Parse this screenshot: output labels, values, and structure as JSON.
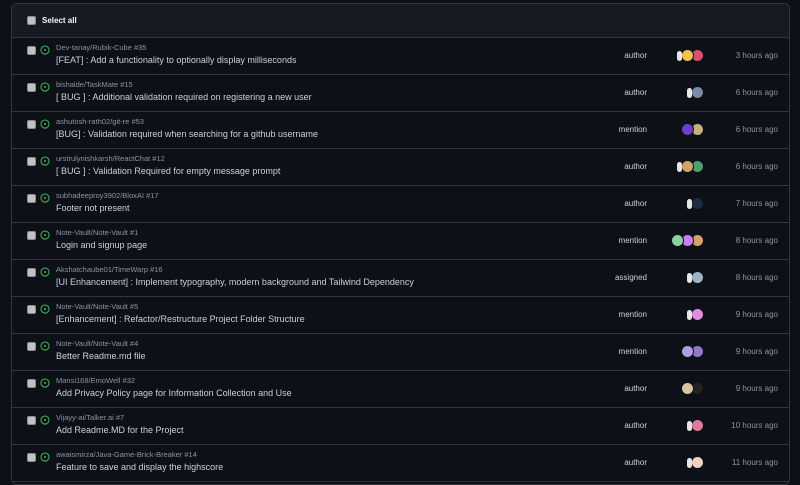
{
  "header": {
    "select_all_label": "Select all"
  },
  "colors": {
    "open_issue": "#3fb950",
    "muted": "#8b949e",
    "border": "#30363d"
  },
  "notifications": [
    {
      "repo": "Dev-tanay/Rubik-Cube #35",
      "title": "[FEAT] : Add a functionality to optionally display milliseconds",
      "reason": "author",
      "time": "3 hours ago",
      "avatars": [
        "#e6e6e6",
        "#f2c14e",
        "#d94f70"
      ]
    },
    {
      "repo": "bishalde/TaskMate #15",
      "title": "[ BUG ] : Additional validation required on registering a new user",
      "reason": "author",
      "time": "6 hours ago",
      "avatars": [
        "#e6e6e6",
        "#7a8ca5"
      ]
    },
    {
      "repo": "ashutosh-rath02/git-re #53",
      "title": "[BUG] : Validation required when searching for a github username",
      "reason": "mention",
      "time": "6 hours ago",
      "avatars": [
        "#6e40c9",
        "#c9b27a"
      ]
    },
    {
      "repo": "urstrulynishkarsh/ReactChat #12",
      "title": "[ BUG ] : Validation Required for empty message prompt",
      "reason": "author",
      "time": "6 hours ago",
      "avatars": [
        "#e6e6e6",
        "#d9a066",
        "#4c9f70"
      ]
    },
    {
      "repo": "subhadeeproy3902/BloxAI #17",
      "title": "Footer not present",
      "reason": "author",
      "time": "7 hours ago",
      "avatars": [
        "#e6e6e6",
        "#1f2a44"
      ]
    },
    {
      "repo": "Note-Vault/Note-Vault #1",
      "title": "Login and signup page",
      "reason": "mention",
      "time": "8 hours ago",
      "avatars": [
        "#8fd19e",
        "#c77dff",
        "#d9a066"
      ]
    },
    {
      "repo": "Akshatchaube01/TimeWarp #16",
      "title": "[UI Enhancement] : Implement typography, modern background and Tailwind Dependency",
      "reason": "assigned",
      "time": "8 hours ago",
      "avatars": [
        "#e6e6e6",
        "#9fb3c8"
      ]
    },
    {
      "repo": "Note-Vault/Note-Vault #5",
      "title": "[Enhancement] : Refactor/Restructure Project Folder Structure",
      "reason": "mention",
      "time": "9 hours ago",
      "avatars": [
        "#e6e6e6",
        "#e08ce0"
      ]
    },
    {
      "repo": "Note-Vault/Note-Vault #4",
      "title": "Better Readme.md file",
      "reason": "mention",
      "time": "9 hours ago",
      "avatars": [
        "#b39ddb",
        "#9575cd"
      ]
    },
    {
      "repo": "Mansi168/EmoWell #32",
      "title": "Add Privacy Policy page for Information Collection and Use",
      "reason": "author",
      "time": "9 hours ago",
      "avatars": [
        "#d9c4a0",
        "#222222"
      ]
    },
    {
      "repo": "Vijayy-ai/Talker.ai #7",
      "title": "Add Readme.MD for the Project",
      "reason": "author",
      "time": "10 hours ago",
      "avatars": [
        "#e6e6e6",
        "#e07a9a"
      ]
    },
    {
      "repo": "awaismirza/Java-Game-Brick-Breaker #14",
      "title": "Feature to save and display the highscore",
      "reason": "author",
      "time": "11 hours ago",
      "avatars": [
        "#e6e6e6",
        "#f0d0c0"
      ]
    }
  ]
}
